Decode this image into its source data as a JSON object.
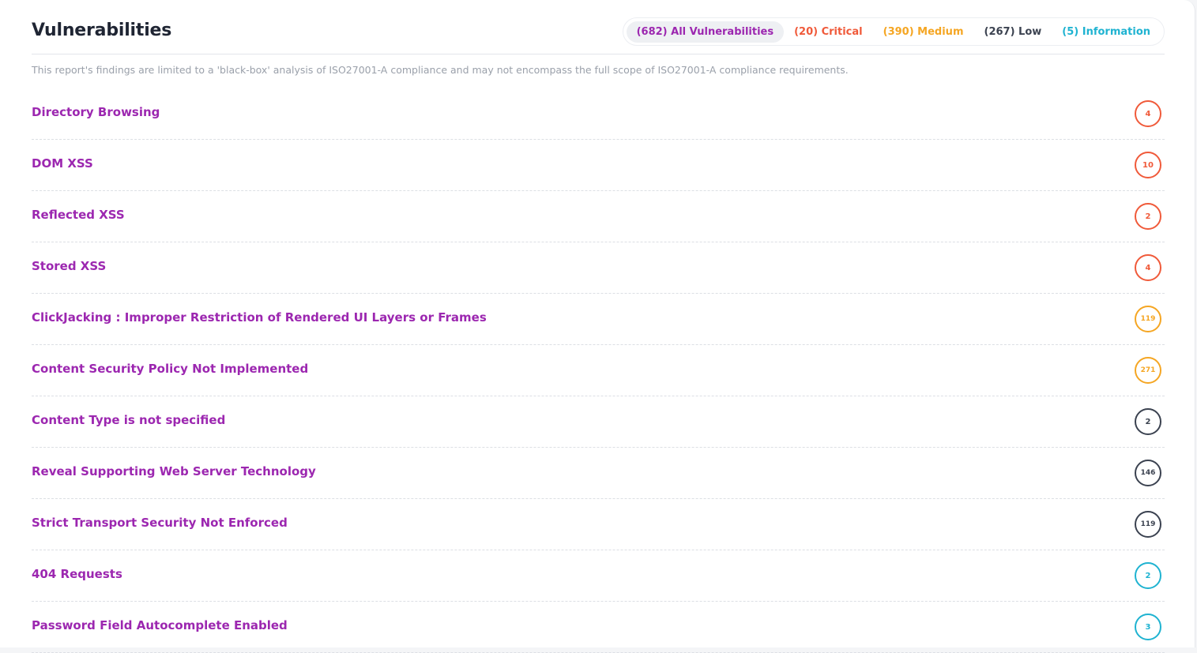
{
  "header": {
    "title": "Vulnerabilities"
  },
  "filters": [
    {
      "label": "(682) All Vulnerabilities",
      "color": "#9c27b0",
      "active": true
    },
    {
      "label": "(20) Critical",
      "color": "#f05a3a",
      "active": false
    },
    {
      "label": "(390) Medium",
      "color": "#f5a623",
      "active": false
    },
    {
      "label": "(267) Low",
      "color": "#3b4250",
      "active": false
    },
    {
      "label": "(5) Information",
      "color": "#1fb3d1",
      "active": false
    }
  ],
  "disclaimer": "This report's findings are limited to a 'black-box' analysis of ISO27001-A compliance and may not encompass the full scope of ISO27001-A compliance requirements.",
  "severity_colors": {
    "critical": "#f05a3a",
    "medium": "#f5a623",
    "low": "#3b4250",
    "information": "#1fb3d1"
  },
  "vulnerabilities": [
    {
      "name": "Directory Browsing",
      "count": "4",
      "severity": "critical"
    },
    {
      "name": "DOM XSS",
      "count": "10",
      "severity": "critical"
    },
    {
      "name": "Reflected XSS",
      "count": "2",
      "severity": "critical"
    },
    {
      "name": "Stored XSS",
      "count": "4",
      "severity": "critical"
    },
    {
      "name": "ClickJacking : Improper Restriction of Rendered UI Layers or Frames",
      "count": "119",
      "severity": "medium"
    },
    {
      "name": "Content Security Policy Not Implemented",
      "count": "271",
      "severity": "medium"
    },
    {
      "name": "Content Type is not specified",
      "count": "2",
      "severity": "low"
    },
    {
      "name": "Reveal Supporting Web Server Technology",
      "count": "146",
      "severity": "low"
    },
    {
      "name": "Strict Transport Security Not Enforced",
      "count": "119",
      "severity": "low"
    },
    {
      "name": "404 Requests",
      "count": "2",
      "severity": "information"
    },
    {
      "name": "Password Field Autocomplete Enabled",
      "count": "3",
      "severity": "information"
    }
  ]
}
